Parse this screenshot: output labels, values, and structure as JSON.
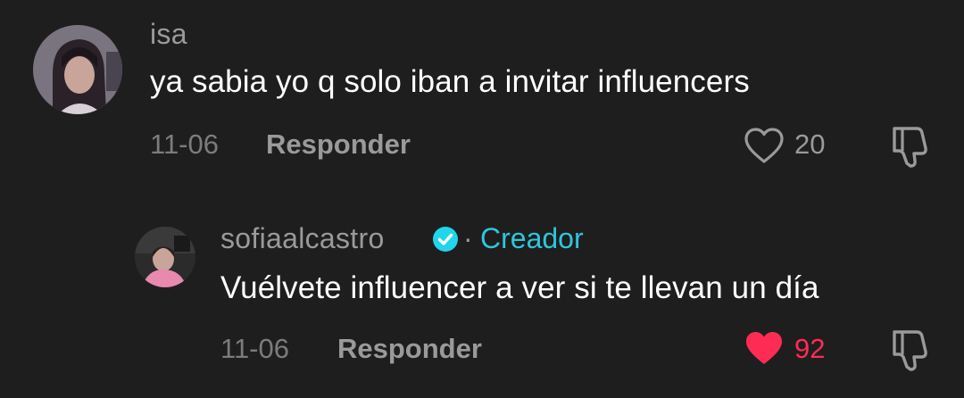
{
  "comments": [
    {
      "username": "isa",
      "text": "ya sabia yo q solo iban a invitar influencers",
      "date": "11-06",
      "reply_label": "Responder",
      "likes": "20",
      "liked": false,
      "like_icon": "heart-outline-icon",
      "dislike_icon": "thumbs-down-icon"
    },
    {
      "username": "sofiaalcastro",
      "separator": "·",
      "creator_label": "Creador",
      "verified_icon": "verified-badge-icon",
      "text": "Vuélvete influencer a ver si te llevan un día",
      "date": "11-06",
      "reply_label": "Responder",
      "likes": "92",
      "liked": true,
      "like_icon": "heart-filled-icon",
      "dislike_icon": "thumbs-down-icon"
    }
  ],
  "colors": {
    "background": "#1e1e1e",
    "creator_accent": "#2fc5dc",
    "liked_heart": "#fe2c55",
    "verified_badge": "#20d5ec"
  }
}
